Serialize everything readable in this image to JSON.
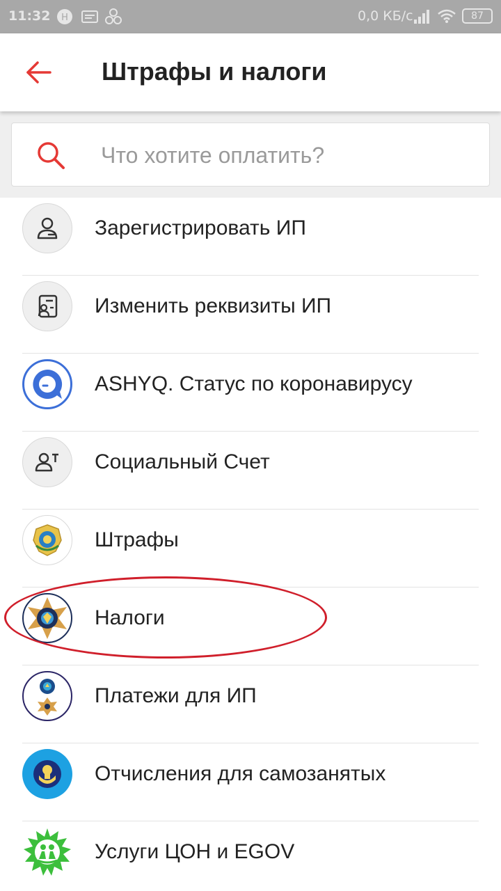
{
  "status_bar": {
    "time": "11:32",
    "network_speed": "0,0 КБ/с",
    "battery": "87"
  },
  "header": {
    "title": "Штрафы и налоги",
    "accent_color": "#e53935"
  },
  "search": {
    "placeholder": "Что хотите оплатить?"
  },
  "items": [
    {
      "label": "Зарегистрировать ИП",
      "icon": "person-outline-icon"
    },
    {
      "label": "Изменить реквизиты ИП",
      "icon": "id-card-icon"
    },
    {
      "label": "ASHYQ. Статус по коронавирусу",
      "icon": "ashyq-chat-icon"
    },
    {
      "label": "Социальный Счет",
      "icon": "person-account-icon"
    },
    {
      "label": "Штрафы",
      "icon": "police-emblem-icon"
    },
    {
      "label": "Налоги",
      "icon": "tax-emblem-icon"
    },
    {
      "label": "Платежи для ИП",
      "icon": "ip-payments-emblem-icon"
    },
    {
      "label": "Отчисления для самозанятых",
      "icon": "self-employed-emblem-icon"
    },
    {
      "label": "Услуги ЦОН и EGOV",
      "icon": "con-egov-emblem-icon"
    }
  ],
  "annotation": {
    "highlighted_item": "Налоги",
    "color": "#d01f2b"
  }
}
